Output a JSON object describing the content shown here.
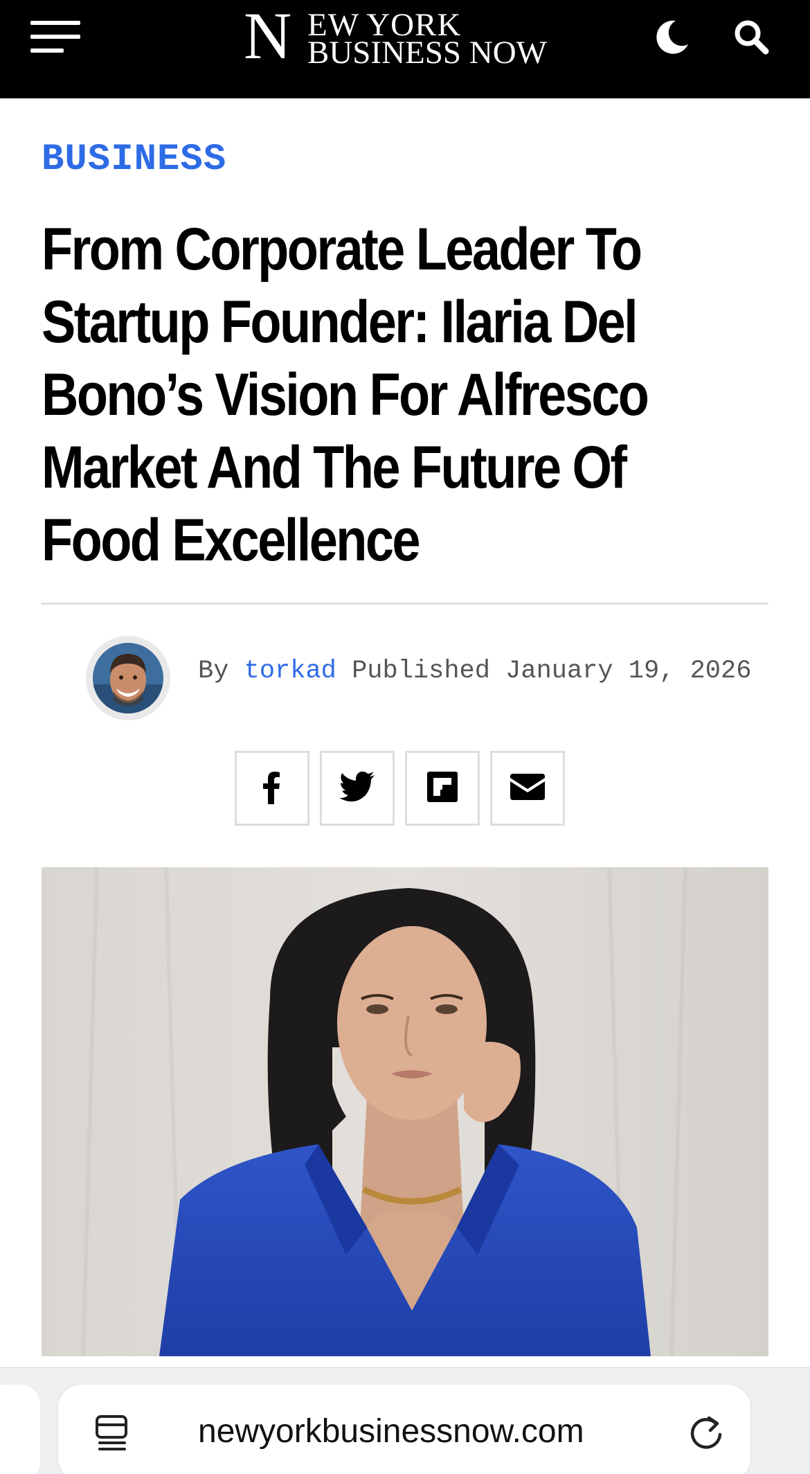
{
  "header": {
    "logo_initial": "N",
    "logo_line1": "EW YORK",
    "logo_line2": "BUSINESS NOW",
    "icons": [
      "menu-icon",
      "moon-icon",
      "search-icon"
    ]
  },
  "article": {
    "category": "BUSINESS",
    "title_lines": [
      "From Corporate Leader To",
      "Startup Founder: Ilaria Del",
      "Bono’s Vision For Alfresco",
      "Market And The Future Of",
      "Food Excellence"
    ],
    "byline": {
      "by_label": "By",
      "author": "torkad",
      "published_label": "Published",
      "date": "January 19, 2026"
    },
    "share_icons": [
      "facebook-icon",
      "twitter-icon",
      "flipboard-icon",
      "email-icon"
    ]
  },
  "browser": {
    "url": "newyorkbusinessnow.com",
    "icons": [
      "reader-mode-icon",
      "reload-icon"
    ]
  },
  "colors": {
    "accent": "#2e6be6",
    "header_bg": "#000000",
    "text": "#000000"
  }
}
